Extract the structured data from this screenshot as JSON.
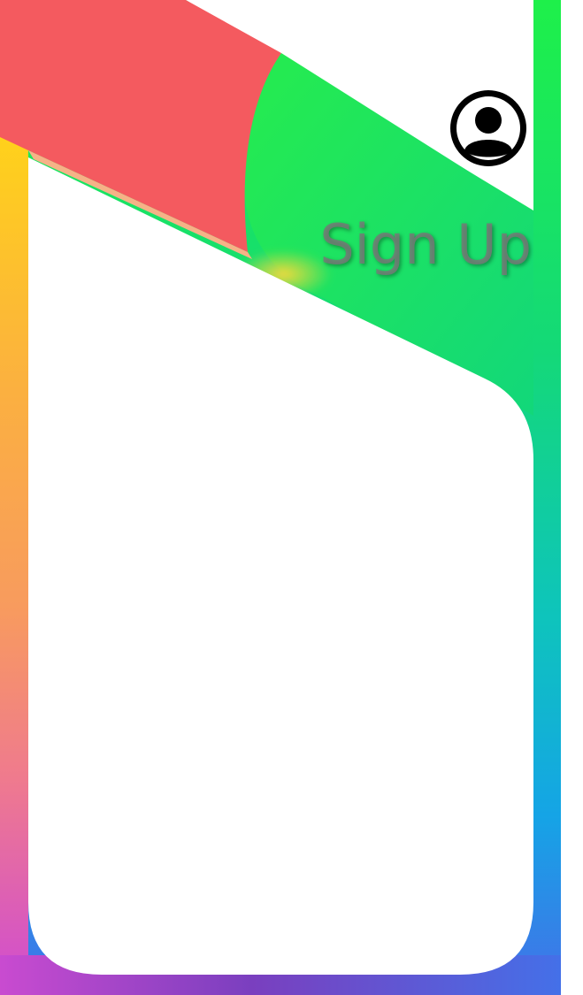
{
  "page": {
    "title": "Sign Up"
  },
  "icons": {
    "avatar": "user-circle-icon"
  },
  "colors": {
    "red": "#f45a5f",
    "green": "#1ee84a",
    "teal": "#12c9a2",
    "blue": "#3d7df0",
    "purple": "#7a3fc0",
    "magenta": "#d04ccf",
    "yellow": "#ffd21a",
    "orange": "#f9a057",
    "pink": "#f07a8f",
    "title_text": "#7a7a7a",
    "panel": "#ffffff"
  }
}
